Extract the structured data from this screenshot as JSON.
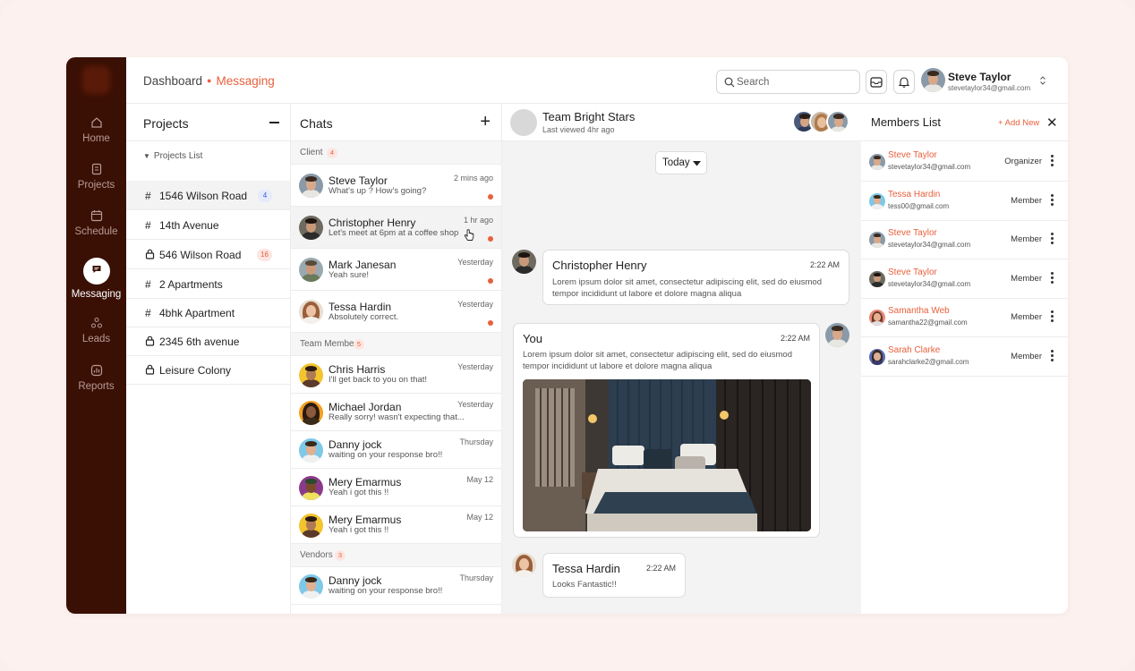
{
  "sidebar": {
    "items": [
      {
        "label": "Home",
        "icon": "home-icon"
      },
      {
        "label": "Projects",
        "icon": "projects-icon"
      },
      {
        "label": "Schedule",
        "icon": "calendar-icon"
      },
      {
        "label": "Messaging",
        "icon": "chat-icon"
      },
      {
        "label": "Leads",
        "icon": "leads-icon"
      },
      {
        "label": "Reports",
        "icon": "reports-icon"
      }
    ],
    "active": "Messaging"
  },
  "header": {
    "breadcrumb": [
      "Dashboard",
      "Messaging"
    ],
    "search_placeholder": "Search",
    "user": {
      "name": "Steve Taylor",
      "email": "stevetaylor34@gmail.com"
    }
  },
  "projects": {
    "title": "Projects",
    "list_label": "Projects List",
    "items": [
      {
        "icon": "#",
        "name": "1546 Wilson Road",
        "badge": "4"
      },
      {
        "icon": "#",
        "name": "14th Avenue",
        "badge": ""
      },
      {
        "icon": "lock",
        "name": "546 Wilson Road",
        "badge": "16"
      },
      {
        "icon": "#",
        "name": "2 Apartments",
        "badge": ""
      },
      {
        "icon": "#",
        "name": "4bhk Apartment",
        "badge": ""
      },
      {
        "icon": "lock",
        "name": "2345 6th avenue",
        "badge": ""
      },
      {
        "icon": "lock",
        "name": "Leisure Colony",
        "badge": ""
      }
    ]
  },
  "chats": {
    "title": "Chats",
    "sections": [
      {
        "title": "Client",
        "count": "4"
      },
      {
        "title": "Team Members",
        "count": "5"
      },
      {
        "title": "Vendors",
        "count": "3"
      }
    ],
    "client": [
      {
        "name": "Steve Taylor",
        "msg": "What's up ? How's going?",
        "time": "2 mins ago"
      },
      {
        "name": "Christopher Henry",
        "msg": "Let's meet at 6pm at a coffee shop",
        "time": "1 hr ago"
      },
      {
        "name": "Mark Janesan",
        "msg": "Yeah sure!",
        "time": "Yesterday"
      },
      {
        "name": "Tessa Hardin",
        "msg": "Absolutely correct.",
        "time": "Yesterday"
      }
    ],
    "team": [
      {
        "name": "Chris Harris",
        "msg": "I'll get back to you on that!",
        "time": "Yesterday"
      },
      {
        "name": "Michael Jordan",
        "msg": "Really sorry! wasn't expecting that...",
        "time": "Yesterday"
      },
      {
        "name": "Danny jock",
        "msg": "waiting on your response bro!!",
        "time": "Thursday"
      },
      {
        "name": "Mery Emarmus",
        "msg": "Yeah i got this !!",
        "time": "May 12"
      },
      {
        "name": "Mery Emarmus",
        "msg": "Yeah i got this !!",
        "time": "May 12"
      }
    ],
    "vendors": [
      {
        "name": "Danny jock",
        "msg": "waiting on your response bro!!",
        "time": "Thursday"
      }
    ]
  },
  "conversation": {
    "group_name": "Team Bright Stars",
    "last_viewed": "Last viewed 4hr ago",
    "date_filter": "Today",
    "messages": [
      {
        "sender": "Christopher Henry",
        "time": "2:22 AM",
        "lines": [
          "Lorem ipsum dolor sit amet, consectetur adipiscing elit, sed do eiusmod",
          "tempor incididunt ut labore et dolore magna aliqua"
        ]
      },
      {
        "sender": "You",
        "time": "2:22 AM",
        "lines": [
          "Lorem ipsum dolor sit amet, consectetur adipiscing elit, sed do eiusmod",
          "tempor incididunt ut labore et dolore magna aliqua"
        ]
      },
      {
        "sender": "Tessa Hardin",
        "time": "2:22 AM",
        "lines": [
          "Looks Fantastic!!"
        ]
      }
    ]
  },
  "members": {
    "title": "Members List",
    "add_label": "+ Add New",
    "list": [
      {
        "name": "Steve Taylor",
        "email": "stevetaylor34@gmail.com",
        "role": "Organizer"
      },
      {
        "name": "Tessa Hardin",
        "email": "tess00@gmail.com",
        "role": "Member"
      },
      {
        "name": "Steve Taylor",
        "email": "stevetaylor34@gmail.com",
        "role": "Member"
      },
      {
        "name": "Steve Taylor",
        "email": "stevetaylor34@gmail.com",
        "role": "Member"
      },
      {
        "name": "Samantha Web",
        "email": "samantha22@gmail.com",
        "role": "Member"
      },
      {
        "name": "Sarah Clarke",
        "email": "sarahclarke2@gmail.com",
        "role": "Member"
      }
    ]
  },
  "colors": {
    "accent": "#e8603c",
    "sidebar": "#3a1005"
  }
}
